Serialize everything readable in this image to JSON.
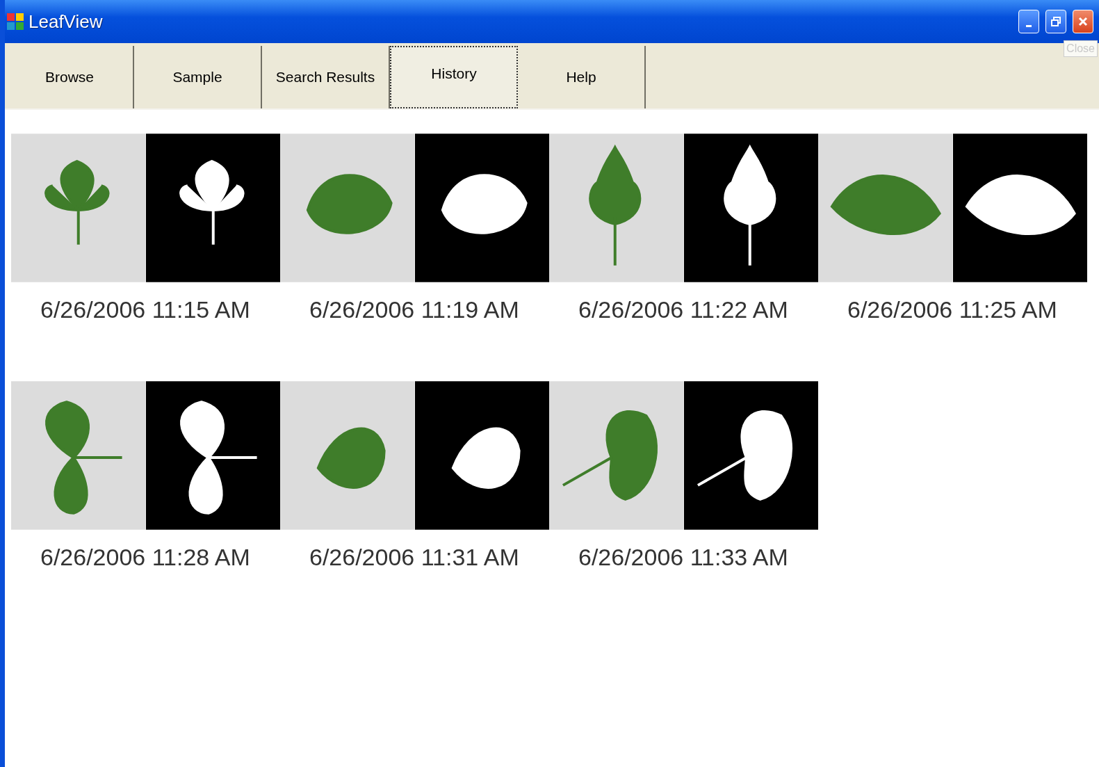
{
  "window": {
    "title": "LeafView",
    "tooltip": "Close"
  },
  "tabs": [
    {
      "label": "Browse",
      "selected": false
    },
    {
      "label": "Sample",
      "selected": false
    },
    {
      "label": "Search Results",
      "selected": false
    },
    {
      "label": "History",
      "selected": true
    },
    {
      "label": "Help",
      "selected": false
    }
  ],
  "history": [
    {
      "timestamp": "6/26/2006 11:15 AM"
    },
    {
      "timestamp": "6/26/2006 11:19 AM"
    },
    {
      "timestamp": "6/26/2006 11:22 AM"
    },
    {
      "timestamp": "6/26/2006 11:25 AM"
    },
    {
      "timestamp": "6/26/2006 11:28 AM"
    },
    {
      "timestamp": "6/26/2006 11:31 AM"
    },
    {
      "timestamp": "6/26/2006 11:33 AM"
    }
  ]
}
